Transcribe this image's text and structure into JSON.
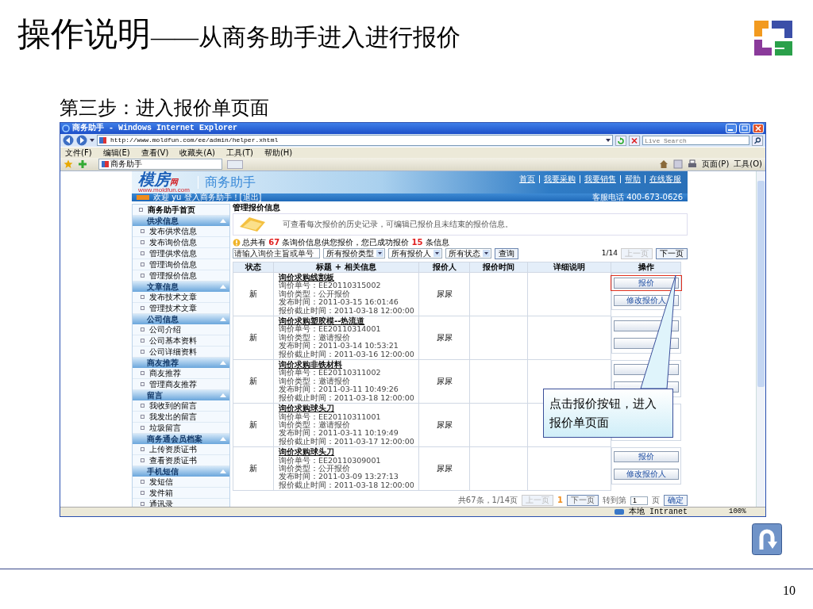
{
  "slide": {
    "title": "操作说明",
    "title_suffix": "——从商务助手进入进行报价",
    "subtitle": "第三步：进入报价单页面",
    "page_number": "10"
  },
  "browser": {
    "title": "商务助手 - Windows Internet Explorer",
    "address": "http://www.moldfun.com/ee/admin/helper.xhtml",
    "search_placeholder": "Live Search",
    "menu": [
      "文件(F)",
      "编辑(E)",
      "查看(V)",
      "收藏夹(A)",
      "工具(T)",
      "帮助(H)"
    ],
    "tab": "商务助手",
    "toolbar": [
      "页面(P)",
      "工具(O)"
    ],
    "status_zone": "本地 Intranet",
    "zoom": "100%"
  },
  "site": {
    "logo": "模房",
    "logo_mark": "网",
    "logo_url": "www.moldfun.com",
    "app_name": "商务助手",
    "top_links": [
      "首页",
      "我要采购",
      "我要销售",
      "帮助",
      "在线客服"
    ],
    "welcome": "欢迎 yu 登入商务助手！[退出]",
    "hotline": "客服电话 400-673-0626"
  },
  "sidebar": {
    "home": "商务助手首页",
    "sections": [
      {
        "title": "供求信息",
        "expanded": true,
        "items": [
          "发布供求信息",
          "发布询价信息",
          "管理供求信息",
          "管理询价信息",
          "管理报价信息"
        ]
      },
      {
        "title": "文章信息",
        "expanded": true,
        "items": [
          "发布技术文章",
          "管理技术文章"
        ]
      },
      {
        "title": "公司信息",
        "expanded": true,
        "items": [
          "公司介绍",
          "公司基本资料",
          "公司详细资料"
        ]
      },
      {
        "title": "商友推荐",
        "expanded": true,
        "items": [
          "商友推荐",
          "管理商友推荐"
        ]
      },
      {
        "title": "留言",
        "expanded": true,
        "items": [
          "我收到的留言",
          "我发出的留言",
          "垃圾留言"
        ]
      },
      {
        "title": "商务通会员档案",
        "expanded": true,
        "items": [
          "上传资质证书",
          "查看资质证书"
        ]
      },
      {
        "title": "手机短信",
        "expanded": true,
        "items": [
          "发短信",
          "发件箱",
          "通讯录"
        ]
      }
    ]
  },
  "main": {
    "heading": "管理报价信息",
    "info": "可查看每次报价的历史记录，可编辑已报价且未结束的报价信息。",
    "summary": "总共有 **67** 条询价信息供您报价，您已成功报价 **15** 条信息",
    "filters": {
      "search_placeholder": "请输入询价主旨或单号",
      "selects": [
        "所有报价类型",
        "所有报价人",
        "所有状态"
      ],
      "button": "查询"
    },
    "pager_top": {
      "page": "1/14",
      "prev": "上一页",
      "prev_disabled": true,
      "next": "下一页"
    },
    "columns": [
      "状态",
      "标题 + 相关信息",
      "报价人",
      "报价时间",
      "详细说明",
      "操作"
    ],
    "rows": [
      {
        "status": "新",
        "title": "询价求购线割板",
        "details": [
          "询价单号：EE20110315002",
          "询价类型：公开报价",
          "发布时间：2011-03-15 16:01:46",
          "报价截止时间：2011-03-18 12:00:00"
        ],
        "quoter": "尿尿",
        "actions": [
          {
            "label": "报价",
            "highlighted": true
          },
          {
            "label": "修改报价人",
            "highlighted": false
          }
        ]
      },
      {
        "status": "新",
        "title": "询价求购塑胶模--热流道",
        "details": [
          "询价单号：EE20110314001",
          "询价类型：邀请报价",
          "发布时间：2011-03-14 10:53:21",
          "报价截止时间：2011-03-16 12:00:00"
        ],
        "quoter": "尿尿",
        "actions": [
          {
            "highlighted": false
          },
          {
            "highlighted": false
          }
        ]
      },
      {
        "status": "新",
        "title": "询价求购非铁材料",
        "details": [
          "询价单号：EE20110311002",
          "询价类型：邀请报价",
          "发布时间：2011-03-11 10:49:26",
          "报价截止时间：2011-03-18 12:00:00"
        ],
        "quoter": "尿尿",
        "actions": [
          {
            "highlighted": false
          },
          {
            "highlighted": false
          }
        ]
      },
      {
        "status": "新",
        "title": "询价求购球头刀",
        "details": [
          "询价单号：EE20110311001",
          "询价类型：邀请报价",
          "发布时间：2011-03-11 10:19:49",
          "报价截止时间：2011-03-17 12:00:00"
        ],
        "quoter": "尿尿"
      },
      {
        "status": "新",
        "title": "询价求购球头刀",
        "details": [
          "询价单号：EE20110309001",
          "询价类型：公开报价",
          "发布时间：2011-03-09 13:27:13",
          "报价截止时间：2011-03-18 12:00:00"
        ],
        "quoter": "尿尿",
        "actions": [
          {
            "label": "报价",
            "highlighted": false
          },
          {
            "label": "修改报价人",
            "highlighted": false
          }
        ]
      }
    ],
    "pager_bottom": {
      "total": "共67条，1/14页",
      "prev": "上一页",
      "prev_disabled": true,
      "current": "1",
      "next": "下一页",
      "goto": "转到第",
      "page_value": "1",
      "page_unit": "页",
      "confirm": "确定"
    }
  },
  "callout": "点击报价按钮，进入报价单页面"
}
